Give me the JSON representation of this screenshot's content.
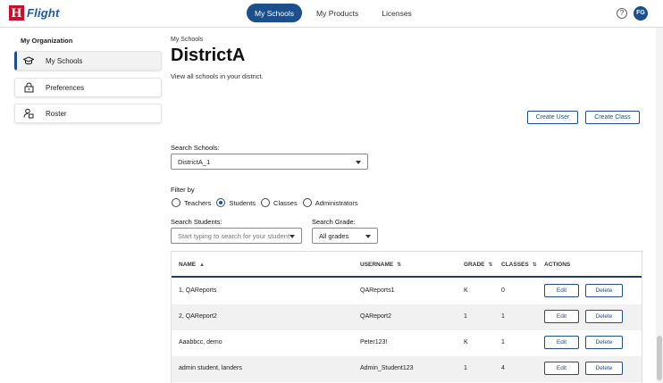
{
  "header": {
    "logo_letter": "H",
    "logo_text": "Flight",
    "nav": [
      {
        "label": "My Schools",
        "active": true
      },
      {
        "label": "My Products",
        "active": false
      },
      {
        "label": "Licenses",
        "active": false
      }
    ],
    "help_symbol": "?",
    "avatar_initials": "FG",
    "accent_color": "#1c4f8b"
  },
  "sidebar": {
    "title": "My Organization",
    "items": [
      {
        "label": "My Schools",
        "icon": "graduation-cap-icon",
        "active": true
      },
      {
        "label": "Preferences",
        "icon": "lock-icon",
        "active": false
      },
      {
        "label": "Roster",
        "icon": "roster-icon",
        "active": false
      }
    ]
  },
  "main": {
    "breadcrumb": "My Schools",
    "title": "DistrictA",
    "subtitle": "View all schools in your district.",
    "create_user_label": "Create User",
    "create_class_label": "Create Class",
    "search_schools_label": "Search Schools:",
    "search_schools_value": "DistrictA_1",
    "filter_label": "Filter by",
    "filters": [
      {
        "label": "Teachers",
        "checked": false
      },
      {
        "label": "Students",
        "checked": true
      },
      {
        "label": "Classes",
        "checked": false
      },
      {
        "label": "Administrators",
        "checked": false
      }
    ],
    "search_students_label": "Search Students:",
    "search_students_placeholder": "Start typing to search for your student",
    "search_grade_label": "Search Grade:",
    "search_grade_value": "All grades"
  },
  "table": {
    "columns": [
      "NAME",
      "USERNAME",
      "GRADE",
      "CLASSES",
      "ACTIONS"
    ],
    "edit_label": "Edit",
    "delete_label": "Delete",
    "rows": [
      {
        "name": "1, QAReports",
        "username": "QAReports1",
        "grade": "K",
        "classes": "0"
      },
      {
        "name": "2, QAReport2",
        "username": "QAReport2",
        "grade": "1",
        "classes": "1"
      },
      {
        "name": "Aaabbcc, demo",
        "username": "Peter123!",
        "grade": "K",
        "classes": "1"
      },
      {
        "name": "admin student, landers",
        "username": "Admin_Student123",
        "grade": "1",
        "classes": "4"
      }
    ]
  }
}
